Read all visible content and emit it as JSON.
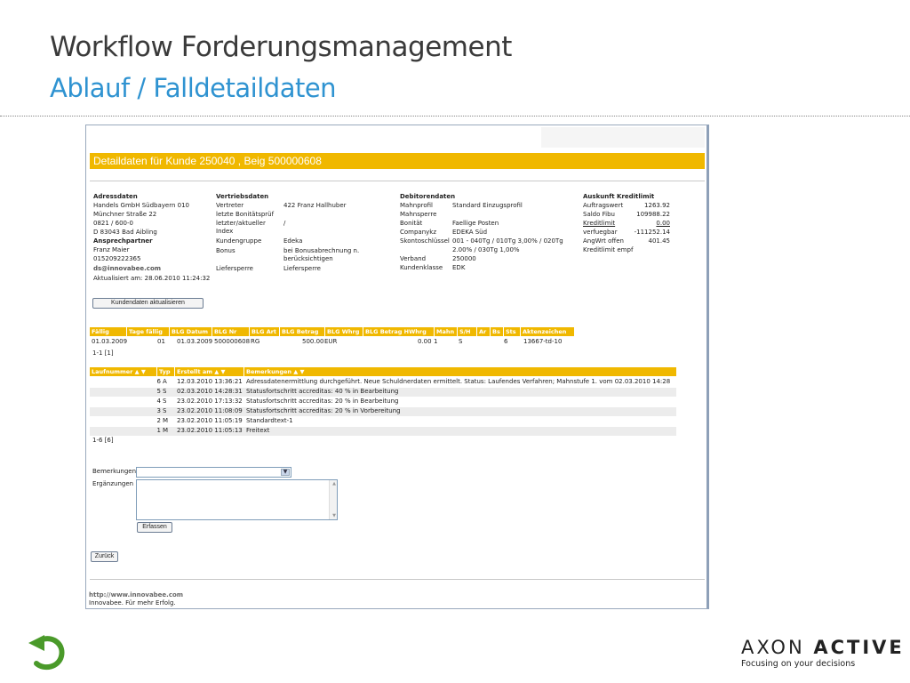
{
  "slide": {
    "title": "Workflow Forderungsmanagement",
    "subtitle": "Ablauf / Falldetaildaten"
  },
  "header_bar": "Detaildaten für Kunde 250040 , Beig 500000608",
  "adressdaten": {
    "heading": "Adressdaten",
    "lines": [
      "Handels GmbH Südbayern 010",
      "Münchner Straße 22",
      "0821 / 600-0",
      "D 83043 Bad Aibling"
    ],
    "contact_heading": "Ansprechpartner",
    "contact_lines": [
      "Franz Maier",
      "015209222365"
    ],
    "email": "ds@innovabee.com",
    "updated": "Aktualisiert am: 28.06.2010 11:24:32"
  },
  "vertrieb": {
    "heading": "Vertriebsdaten",
    "labels": [
      "Vertreter",
      "letzte Bonitätsprüf",
      "letzter/aktueller",
      "Index",
      "Kundengruppe",
      "Bonus",
      "",
      "",
      "Liefersperre"
    ],
    "values": [
      "422 Franz Hallhuber",
      "",
      "/",
      "",
      "Edeka",
      "bei Bonusabrechnung n.",
      "berücksichtigen",
      "",
      "Liefersperre"
    ]
  },
  "debitor": {
    "heading": "Debitorendaten",
    "labels": [
      "Mahnprofil",
      "Mahnsperre",
      "Bonität",
      "Companykz",
      "Skontoschlüssel",
      "",
      "Verband",
      "Kundenklasse"
    ],
    "values": [
      "Standard Einzugsprofil",
      "",
      "Faellige Posten",
      "EDEKA Süd",
      "001 - 040Tg / 010Tg 3,00% / 020Tg",
      "2.00% / 030Tg 1,00%",
      "250000",
      "EDK"
    ]
  },
  "kredit": {
    "heading": "Auskunft Kreditlimit",
    "labels": [
      "Auftragswert",
      "Saldo Fibu",
      "Kreditlimit",
      "verfuegbar",
      "AngWrt offen",
      "Kreditlimit empf"
    ],
    "values": [
      "1263.92",
      "109988.22",
      "0.00",
      "-111252.14",
      "401.45",
      ""
    ]
  },
  "buttons": {
    "update_customer": "Kundendaten aktualisieren",
    "capture": "Erfassen",
    "back": "Zurück"
  },
  "invoice_table": {
    "headers": [
      "Fällig",
      "Tage fällig",
      "BLG Datum",
      "BLG Nr",
      "BLG Art",
      "BLG Betrag",
      "BLG Whrg",
      "BLG Betrag HWhrg",
      "Mahn",
      "S/H",
      "Ar",
      "Bs",
      "Sts",
      "Aktenzeichen"
    ],
    "rows": [
      [
        "01.03.2009",
        "01",
        "01.03.2009",
        "500000608",
        "RG",
        "500.00",
        "EUR",
        "0.00",
        "1",
        "S",
        "",
        "6",
        "",
        "13667-td-10"
      ]
    ],
    "footer": "1-1 [1]"
  },
  "history_table": {
    "headers": [
      "Laufnummer",
      "Typ",
      "Erstellt am",
      "Bemerkungen"
    ],
    "sort_glyph": "▲ ▼",
    "rows": [
      [
        "6",
        "A",
        "12.03.2010 13:36:21",
        "Adressdatenermittlung durchgeführt. Neue Schuldnerdaten ermittelt. Status: Laufendes Verfahren; Mahnstufe 1. vom 02.03.2010 14:28"
      ],
      [
        "5",
        "S",
        "02.03.2010 14:28:31",
        "Statusfortschritt accreditas: 40 % in Bearbeitung"
      ],
      [
        "4",
        "S",
        "23.02.2010 17:13:32",
        "Statusfortschritt accreditas: 20 % in Bearbeitung"
      ],
      [
        "3",
        "S",
        "23.02.2010 11:08:09",
        "Statusfortschritt accreditas: 20 % in Vorbereitung"
      ],
      [
        "2",
        "M",
        "23.02.2010 11:05:19",
        "Standardtext-1"
      ],
      [
        "1",
        "M",
        "23.02.2010 11:05:13",
        "Freitext"
      ]
    ],
    "footer": "1-6 [6]"
  },
  "form": {
    "remarks_label": "Bemerkungen",
    "additions_label": "Ergänzungen"
  },
  "footer": {
    "url": "http://www.innovabee.com",
    "slogan": "Innovabee. Für mehr Erfolg."
  },
  "brand": {
    "name_light": "AXON",
    "name_bold": "ACTIVE",
    "tagline": "Focusing on your decisions",
    "accent": "#f0b800",
    "title_blue": "#2f93d1",
    "arrow_green": "#4a9a2a"
  }
}
